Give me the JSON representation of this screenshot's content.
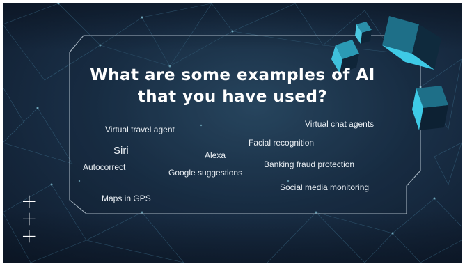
{
  "slide": {
    "title": "What are some examples of AI that you have used?",
    "examples": [
      {
        "text": "Virtual travel agent",
        "size": "normal"
      },
      {
        "text": "Virtual chat agents",
        "size": "normal"
      },
      {
        "text": "Facial recognition",
        "size": "normal"
      },
      {
        "text": "Siri",
        "size": "large"
      },
      {
        "text": "Alexa",
        "size": "normal"
      },
      {
        "text": "Autocorrect",
        "size": "normal"
      },
      {
        "text": "Google suggestions",
        "size": "normal"
      },
      {
        "text": "Banking fraud protection",
        "size": "normal"
      },
      {
        "text": "Social media monitoring",
        "size": "normal"
      },
      {
        "text": "Maps in GPS",
        "size": "normal"
      }
    ],
    "plus_marks": [
      "+",
      "+",
      "+"
    ],
    "colors": {
      "background": "#1a3048",
      "accent_cyan": "#3fa9c4",
      "text": "#ffffff"
    }
  }
}
